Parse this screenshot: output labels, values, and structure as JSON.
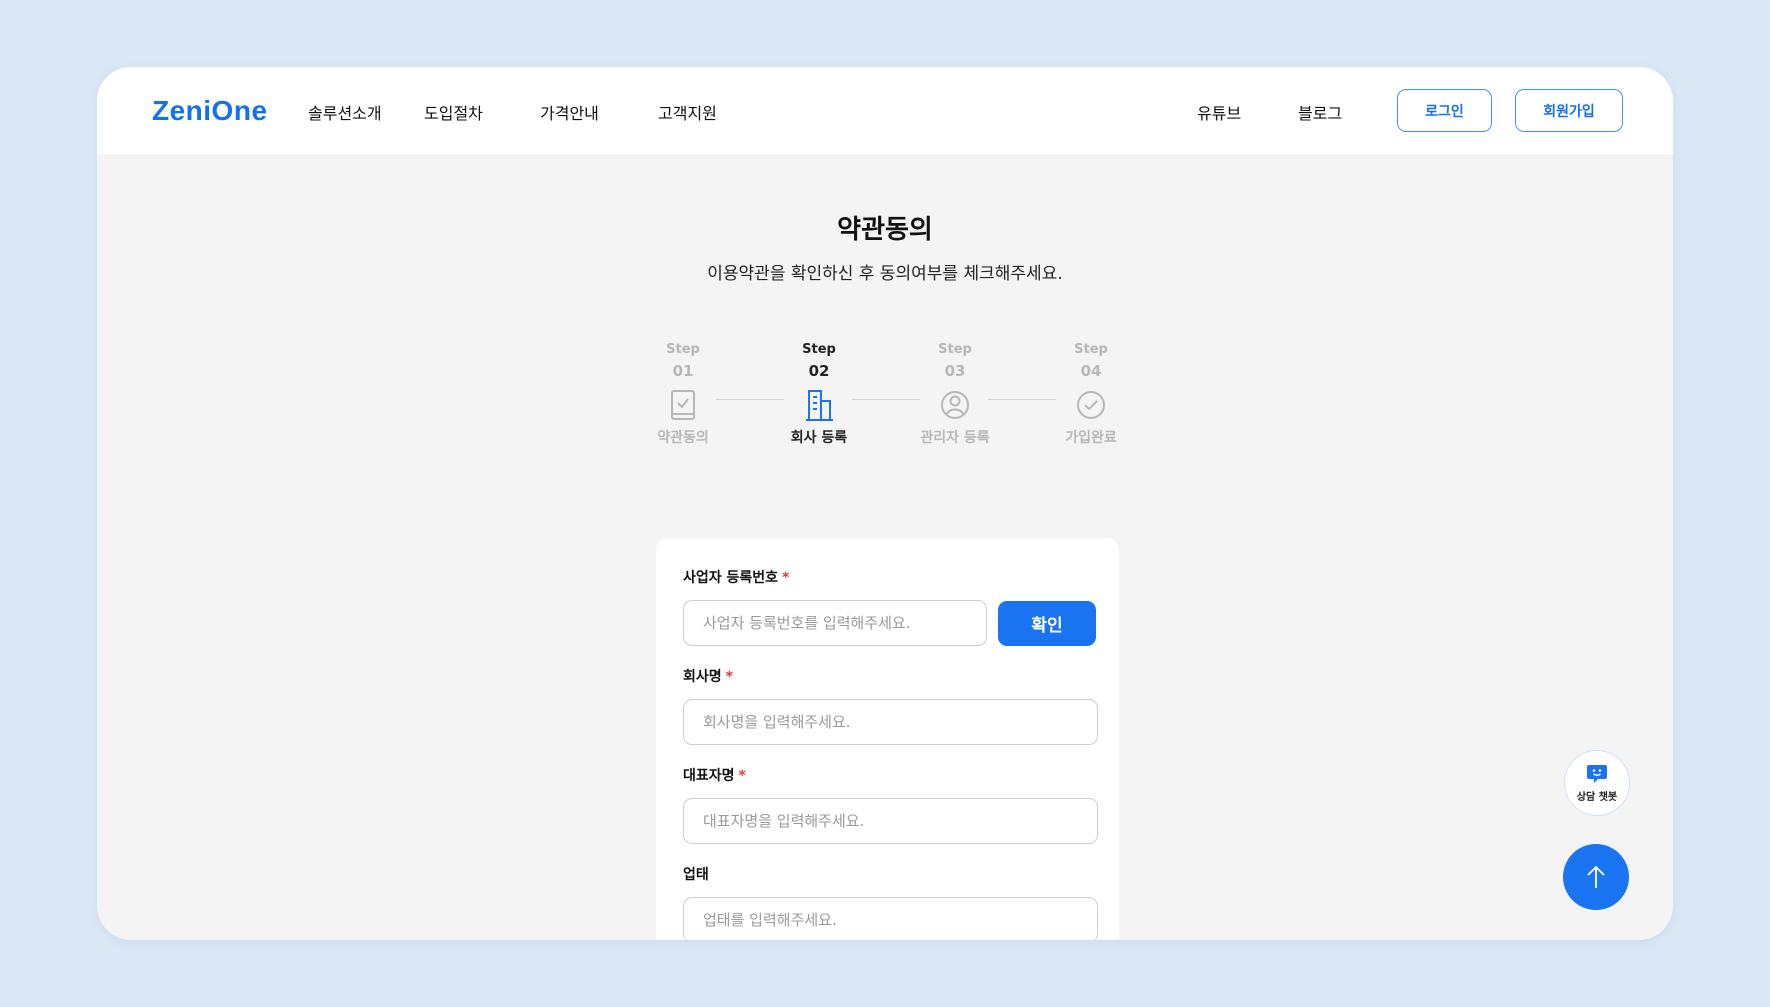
{
  "header": {
    "logo": "ZeniOne",
    "nav": [
      "솔루션소개",
      "도입절차",
      "가격안내",
      "고객지원"
    ],
    "nav_right": [
      "유튜브",
      "블로그"
    ],
    "login_label": "로그인",
    "signup_label": "회원가입"
  },
  "page": {
    "title": "약관동의",
    "subtitle": "이용약관을 확인하신 후 동의여부를 체크해주세요."
  },
  "steps": [
    {
      "label": "Step",
      "num": "01",
      "name": "약관동의",
      "icon": "document-check-icon",
      "active": false
    },
    {
      "label": "Step",
      "num": "02",
      "name": "회사 등록",
      "icon": "building-icon",
      "active": true
    },
    {
      "label": "Step",
      "num": "03",
      "name": "관리자 등록",
      "icon": "user-circle-icon",
      "active": false
    },
    {
      "label": "Step",
      "num": "04",
      "name": "가입완료",
      "icon": "check-circle-icon",
      "active": false
    }
  ],
  "form": {
    "biz_no": {
      "label": "사업자 등록번호",
      "required": "*",
      "placeholder": "사업자 등록번호를 입력해주세요.",
      "button": "확인"
    },
    "company": {
      "label": "회사명",
      "required": "*",
      "placeholder": "회사명을 입력해주세요."
    },
    "ceo": {
      "label": "대표자명",
      "required": "*",
      "placeholder": "대표자명을 입력해주세요."
    },
    "biz_type": {
      "label": "업태",
      "placeholder": "업태를 입력해주세요."
    }
  },
  "widgets": {
    "chatbot_label": "상담 챗봇",
    "chatbot_icon": "chat-bubble-icon",
    "scroll_top_icon": "arrow-up-icon"
  },
  "colors": {
    "accent": "#1a73f0",
    "background": "#dae8f6",
    "required": "#e53935"
  }
}
